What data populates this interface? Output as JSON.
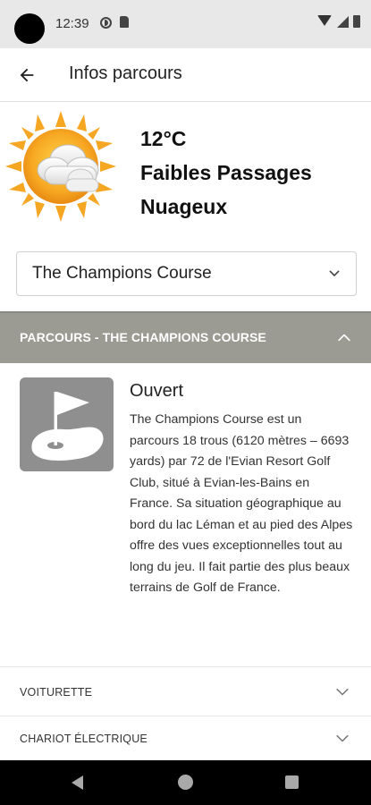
{
  "status_bar": {
    "time": "12:39",
    "icons": [
      "camera-cutout-icon",
      "data-saver-icon",
      "sd-card-icon",
      "wifi-icon",
      "signal-icon",
      "battery-icon"
    ]
  },
  "app_bar": {
    "back_icon": "arrow-left-icon",
    "title": "Infos parcours"
  },
  "weather": {
    "icon": "partly-cloudy-icon",
    "temperature": "12°C",
    "condition_line1": "Faibles Passages",
    "condition_line2": "Nuageux"
  },
  "course_select": {
    "selected": "The Champions Course",
    "icon": "chevron-down-icon"
  },
  "section": {
    "title": "PARCOURS - THE CHAMPIONS COURSE",
    "icon": "chevron-up-icon",
    "color": "#9b9b94"
  },
  "course": {
    "image_icon": "golf-flag-green-icon",
    "status": "Ouvert",
    "description": "The Champions Course est un parcours 18 trous (6120 mètres – 6693 yards) par 72 de l'Evian Resort Golf Club, situé à Evian-les-Bains en France. Sa situation géographique au bord du lac Léman et au pied des Alpes offre des vues exceptionnelles tout au long du jeu. Il fait partie des plus beaux terrains de Golf de France."
  },
  "rows": [
    {
      "label": "VOITURETTE",
      "icon": "chevron-down-icon"
    },
    {
      "label": "CHARIOT ÉLECTRIQUE",
      "icon": "chevron-down-icon"
    }
  ],
  "nav_bar": {
    "icons": [
      "nav-back-icon",
      "nav-home-icon",
      "nav-recents-icon"
    ]
  }
}
